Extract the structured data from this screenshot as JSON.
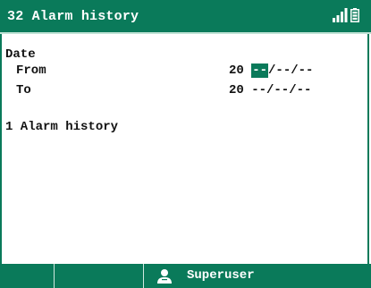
{
  "header": {
    "title": "32 Alarm history",
    "signal_icon": "signal-bars-icon",
    "battery_icon": "battery-icon",
    "bar_color": "#0a7a5a"
  },
  "filter": {
    "date_label": "Date",
    "from_label": "From",
    "from_prefix": "20 ",
    "from_year_selected": "--",
    "from_rest": "/--/--",
    "to_label": "To",
    "to_value": "20 --/--/--"
  },
  "history": {
    "label": "1 Alarm history"
  },
  "footer": {
    "user_icon": "user-icon",
    "user_label": "Superuser"
  }
}
